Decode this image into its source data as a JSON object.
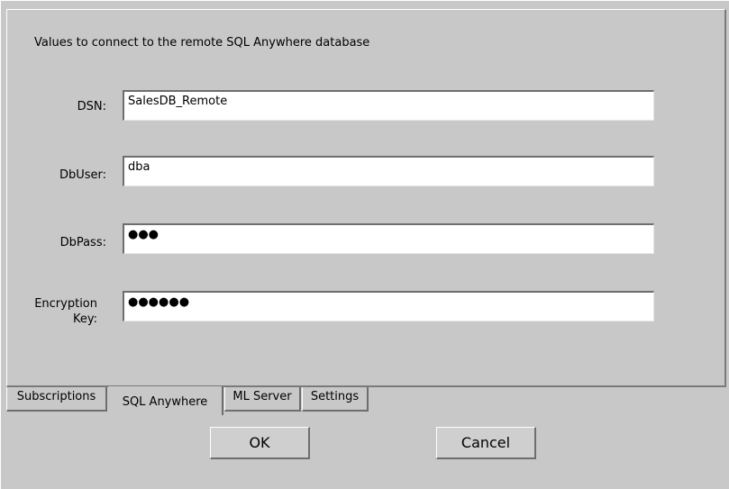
{
  "panel": {
    "description": "Values to connect to the remote SQL Anywhere database"
  },
  "fields": {
    "dsn": {
      "label": "DSN:",
      "value": "SalesDB_Remote"
    },
    "dbuser": {
      "label": "DbUser:",
      "value": "dba"
    },
    "dbpass": {
      "label": "DbPass:",
      "value": "●●●"
    },
    "encryption_key": {
      "label_line1": "Encryption",
      "label_line2": "Key:",
      "value": "●●●●●●"
    }
  },
  "tabs": [
    {
      "label": "Subscriptions",
      "selected": false
    },
    {
      "label": "SQL Anywhere",
      "selected": true
    },
    {
      "label": "ML Server",
      "selected": false
    },
    {
      "label": "Settings",
      "selected": false
    }
  ],
  "buttons": {
    "ok": "OK",
    "cancel": "Cancel"
  }
}
